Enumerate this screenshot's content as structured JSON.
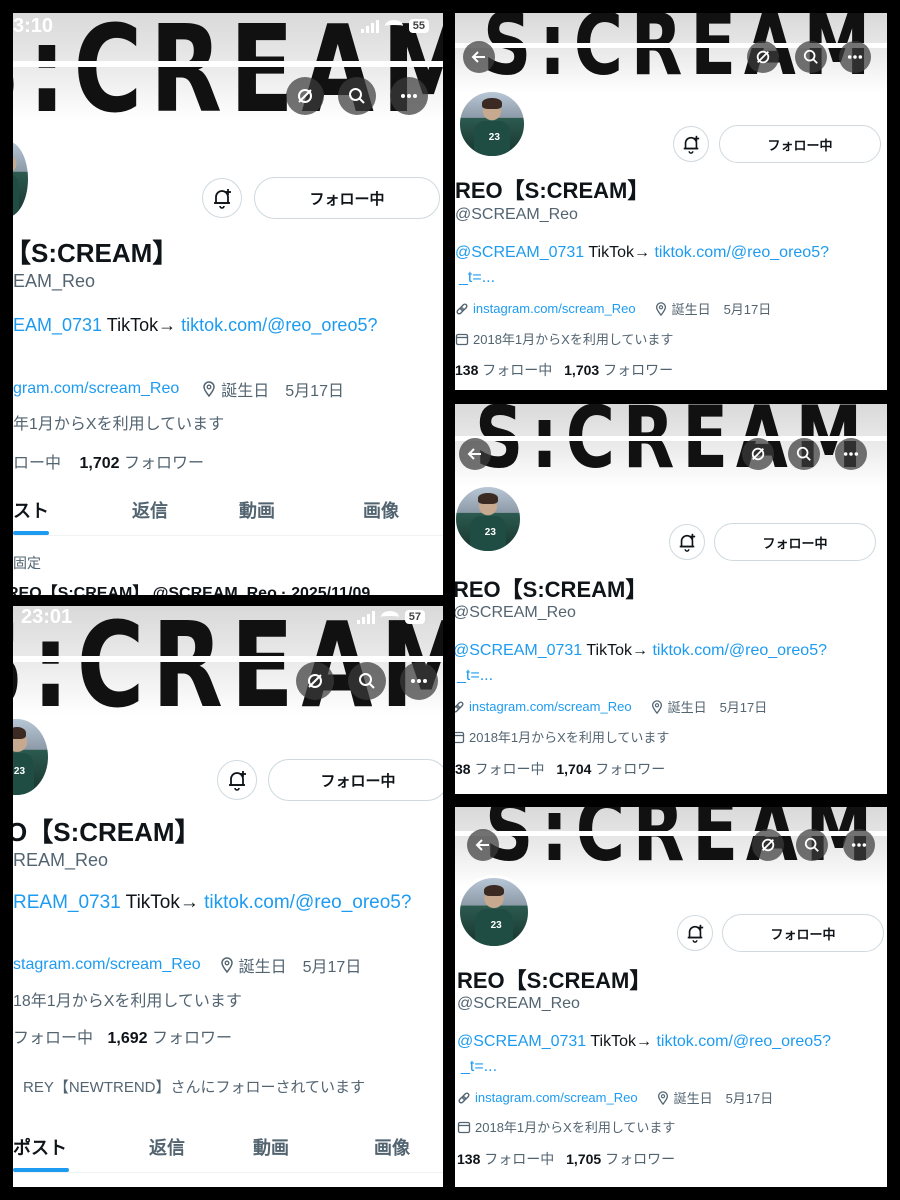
{
  "brand": {
    "banner_text": "S:CREAM",
    "link_color": "#1d9bf0",
    "tab_indicator_color": "#1d9bf0"
  },
  "icons": {
    "back": "back-arrow-icon",
    "no_notify": "slashed-circle-icon",
    "search": "search-icon",
    "more": "more-dots-icon",
    "bell": "bell-plus-icon",
    "link": "link-icon",
    "location": "location-pin-icon",
    "calendar": "calendar-icon"
  },
  "panels": {
    "p1": {
      "status_time": "3:10",
      "battery": "55",
      "follow_label": "フォロー中",
      "name": "【S:CREAM】",
      "handle": "EAM_Reo",
      "bio_mention": "EAM_0731",
      "bio_tiktok_label": "TikTok→",
      "bio_tiktok_link": "tiktok.com/@reo_oreo5?",
      "website": "gram.com/scream_Reo",
      "birthday": "誕生日　5月17日",
      "joined": "年1月からXを利用しています",
      "following_label": "ロー中",
      "followers_count": "1,702",
      "followers_label": "フォロワー",
      "tabs": [
        "スト",
        "返信",
        "動画",
        "画像"
      ],
      "pinned_label": "固定",
      "pinned_line": "REO【S:CREAM】 @SCREAM_Reo · 2025/11/09"
    },
    "p2": {
      "follow_label": "フォロー中",
      "name": "REO【S:CREAM】",
      "handle": "@SCREAM_Reo",
      "bio_mention": "@SCREAM_0731",
      "bio_tiktok_label": "TikTok→",
      "bio_tiktok_link": "tiktok.com/@reo_oreo5?",
      "bio_cont": "_t=...",
      "website": "instagram.com/scream_Reo",
      "birthday": "誕生日　5月17日",
      "joined": "2018年1月からXを利用しています",
      "following_count": "138",
      "following_label": "フォロー中",
      "followers_count": "1,703",
      "followers_label": "フォロワー"
    },
    "p3": {
      "follow_label": "フォロー中",
      "name": "REO【S:CREAM】",
      "handle": "@SCREAM_Reo",
      "bio_mention": "@SCREAM_0731",
      "bio_tiktok_label": "TikTok→",
      "bio_tiktok_link": "tiktok.com/@reo_oreo5?",
      "bio_cont": "_t=...",
      "website": "instagram.com/scream_Reo",
      "birthday": "誕生日　5月17日",
      "joined": "2018年1月からXを利用しています",
      "following_count": "38",
      "following_label": "フォロー中",
      "followers_count": "1,704",
      "followers_label": "フォロワー"
    },
    "p4": {
      "status_time": "23:01",
      "battery": "57",
      "follow_label": "フォロー中",
      "name": "O【S:CREAM】",
      "handle": "REAM_Reo",
      "bio_mention": "REAM_0731",
      "bio_tiktok_label": "TikTok→",
      "bio_tiktok_link": "tiktok.com/@reo_oreo5?",
      "website": "stagram.com/scream_Reo",
      "birthday": "誕生日　5月17日",
      "joined": "18年1月からXを利用しています",
      "following_label": "フォロー中",
      "followers_count": "1,692",
      "followers_label": "フォロワー",
      "followed_by": "REY【NEWTREND】さんにフォローされています",
      "tabs": [
        "ポスト",
        "返信",
        "動画",
        "画像"
      ]
    },
    "p5": {
      "follow_label": "フォロー中",
      "name": "REO【S:CREAM】",
      "handle": "@SCREAM_Reo",
      "bio_mention": "@SCREAM_0731",
      "bio_tiktok_label": "TikTok→",
      "bio_tiktok_link": "tiktok.com/@reo_oreo5?",
      "bio_cont": "_t=...",
      "website": "instagram.com/scream_Reo",
      "birthday": "誕生日　5月17日",
      "joined": "2018年1月からXを利用しています",
      "following_count": "138",
      "following_label": "フォロー中",
      "followers_count": "1,705",
      "followers_label": "フォロワー"
    }
  }
}
